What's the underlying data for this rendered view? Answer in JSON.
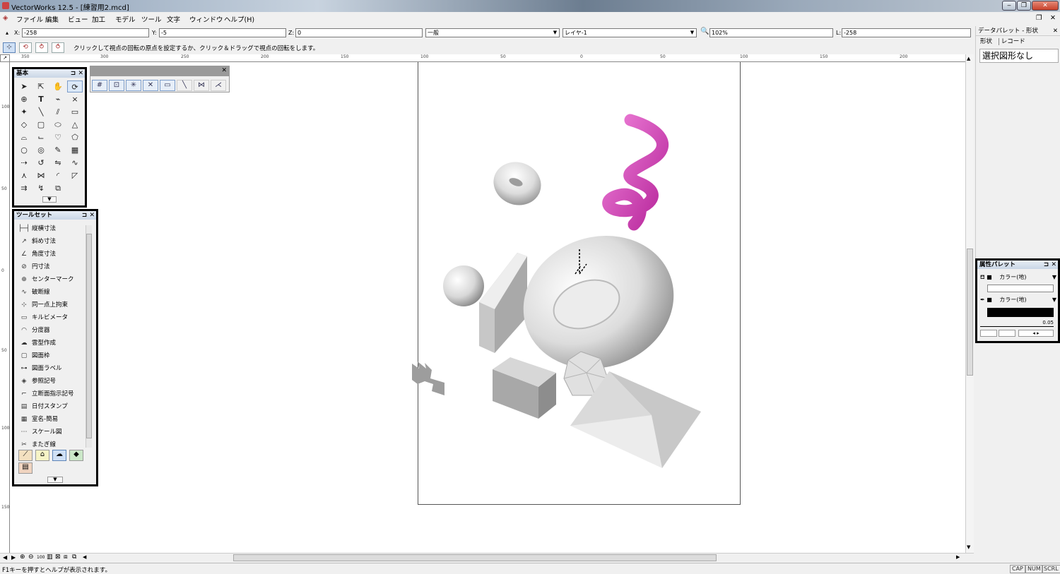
{
  "window": {
    "title": "VectorWorks 12.5 - [練習用2.mcd]",
    "minimize": "‒",
    "restore": "❐",
    "close": "✕"
  },
  "menu": {
    "items": [
      "ファイル",
      "編集",
      "ビュー",
      "加工",
      "モデル",
      "ツール",
      "文字",
      "ウィンドウ",
      "ヘルプ(H)"
    ]
  },
  "doc_controls": {
    "restore": "❐",
    "close": "✕"
  },
  "coord_bar": {
    "x_label": "X:",
    "x_value": "-258",
    "y_label": "Y:",
    "y_value": "-5",
    "z_label": "Z:",
    "z_value": "0",
    "class_value": "一般",
    "layer_value": "レイヤ-1",
    "zoom_value": "102%",
    "length_label": "L:",
    "length_value": "-258"
  },
  "mode_bar": {
    "message": "クリックして視点の回転の原点を設定するか、クリック＆ドラッグで視点の回転をします。"
  },
  "rulers": {
    "horizontal": [
      "350",
      "300",
      "250",
      "200",
      "150",
      "100",
      "50",
      "0",
      "50",
      "100",
      "150",
      "200"
    ],
    "vertical": [
      "100",
      "50",
      "0",
      "50",
      "100",
      "150"
    ]
  },
  "basic_palette": {
    "title": "基本",
    "pin": "⊐",
    "close": "✕"
  },
  "toolset_palette": {
    "title": "ツールセット",
    "pin": "⊐",
    "close": "✕",
    "items": [
      {
        "icon": "├─┤",
        "label": "縦横寸法"
      },
      {
        "icon": "↗",
        "label": "斜め寸法"
      },
      {
        "icon": "∠",
        "label": "角度寸法"
      },
      {
        "icon": "⊘",
        "label": "円寸法"
      },
      {
        "icon": "⊕",
        "label": "センターマーク"
      },
      {
        "icon": "∿",
        "label": "破断線"
      },
      {
        "icon": "⊹",
        "label": "同一点上拘束"
      },
      {
        "icon": "▭",
        "label": "キルビメータ"
      },
      {
        "icon": "◠",
        "label": "分度器"
      },
      {
        "icon": "☁",
        "label": "雲型作成"
      },
      {
        "icon": "▢",
        "label": "図面枠"
      },
      {
        "icon": "⊶",
        "label": "図面ラベル"
      },
      {
        "icon": "◈",
        "label": "参照記号"
      },
      {
        "icon": "⌐",
        "label": "立断面指示記号"
      },
      {
        "icon": "▤",
        "label": "日付スタンプ"
      },
      {
        "icon": "▦",
        "label": "室名-簡易"
      },
      {
        "icon": "⋯",
        "label": "スケール図"
      },
      {
        "icon": "✂",
        "label": "またぎ線"
      }
    ]
  },
  "data_palette": {
    "title": "データパレット - 形状",
    "close": "✕",
    "tabs": [
      "形状",
      "レコード"
    ],
    "selection": "選択図形なし"
  },
  "attribute_palette": {
    "title": "属性パレット",
    "pin": "⊐",
    "close": "✕",
    "fill_label": "カラー(地)",
    "pen_label": "カラー(地)",
    "line_weight": "0.05"
  },
  "status": {
    "text": "F1キーを押すとヘルプが表示されます。",
    "cap": "CAP",
    "num": "NUM",
    "scrl": "SCRL"
  },
  "colors": {
    "accent_pink": "#d63fb8",
    "palette_header": "#c9d6e6",
    "selected_tool": "#dce9f8"
  }
}
